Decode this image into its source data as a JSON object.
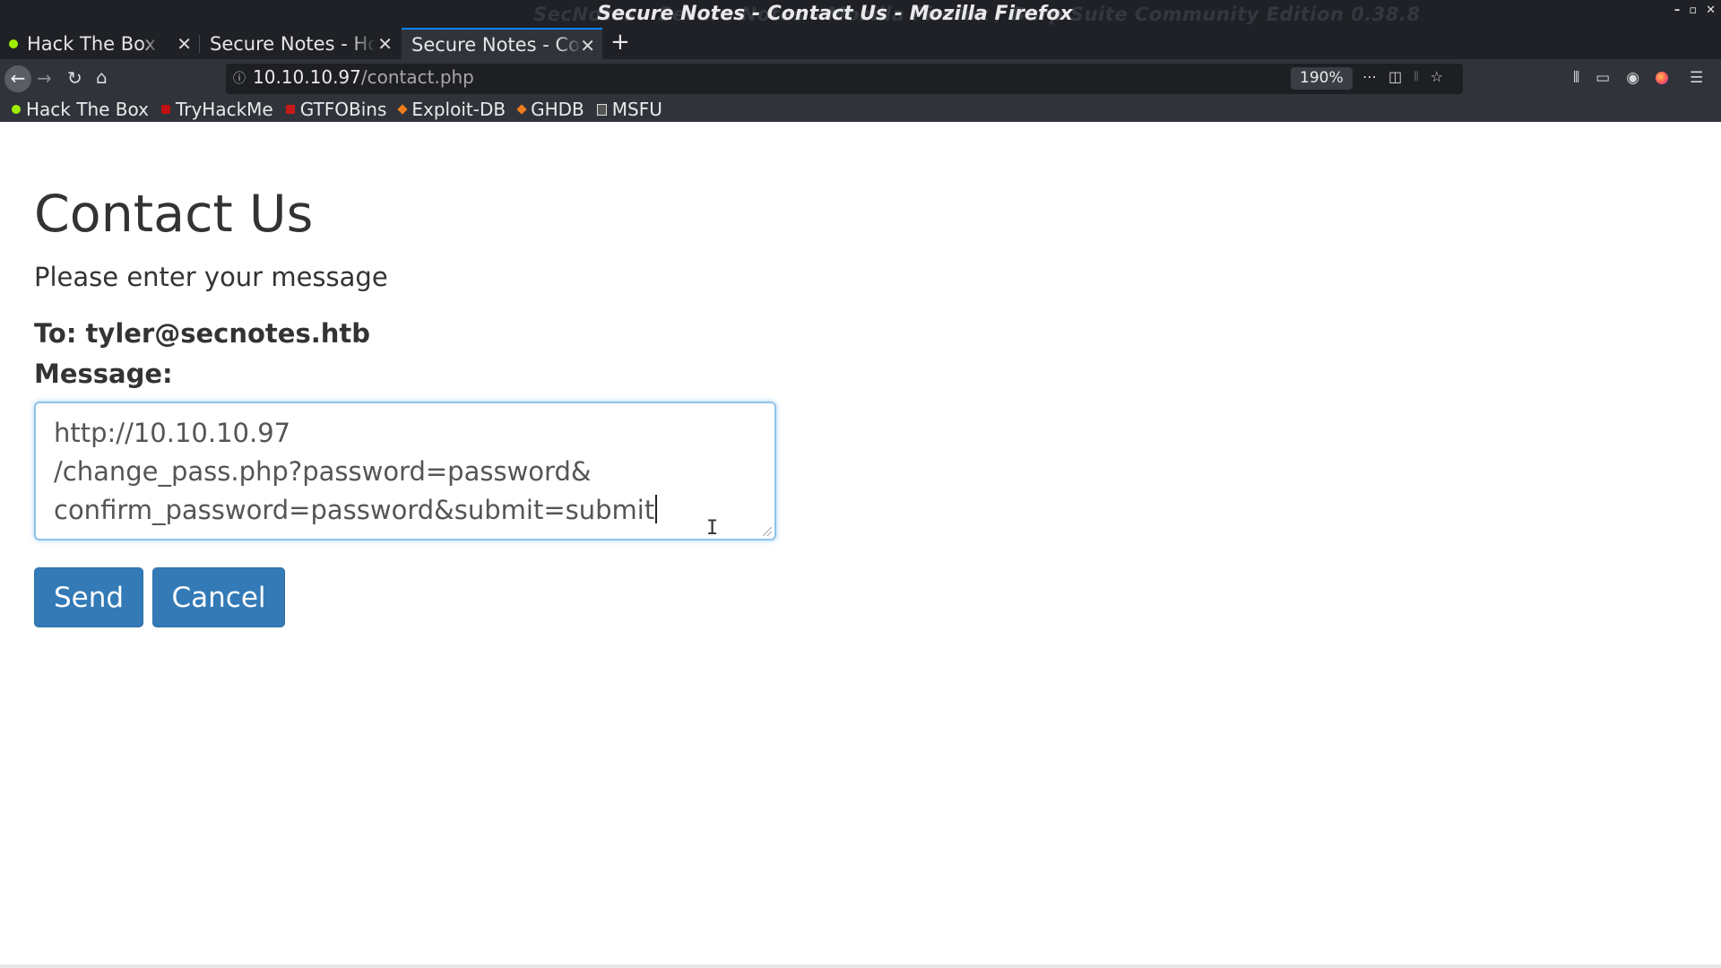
{
  "window": {
    "title": "Secure Notes - Contact Us - Mozilla Firefox",
    "ghost_title": "SecNotes - Secure Notes - Mozilla Firefox / Burp Suite Community Edition 0.38.8",
    "controls": [
      "–",
      "▫",
      "✕"
    ]
  },
  "tabs": [
    {
      "label": "Hack The Box :: Main",
      "active": false
    },
    {
      "label": "Secure Notes - Home",
      "active": false
    },
    {
      "label": "Secure Notes - Contact Us",
      "active": true
    }
  ],
  "navbar": {
    "url_host": "10.10.10.97",
    "url_path": "/contact.php",
    "zoom": "190%"
  },
  "bookmarks": [
    {
      "label": "Hack The Box",
      "icon": "htb-icon"
    },
    {
      "label": "TryHackMe",
      "icon": "tryhackme-icon"
    },
    {
      "label": "GTFOBins",
      "icon": "gtfobins-icon"
    },
    {
      "label": "Exploit-DB",
      "icon": "exploit-db-icon"
    },
    {
      "label": "GHDB",
      "icon": "ghdb-icon"
    },
    {
      "label": "MSFU",
      "icon": "msfu-icon"
    }
  ],
  "page": {
    "title": "Contact Us",
    "subtitle": "Please enter your message",
    "to_line": "To: tyler@secnotes.htb",
    "message_label": "Message:",
    "message_lines": [
      "http://10.10.10.97",
      "/change_pass.php?password=password&",
      "confirm_password=password&submit=submit"
    ],
    "send_label": "Send",
    "cancel_label": "Cancel"
  },
  "colors": {
    "chrome_dark": "#1f2126",
    "toolbar": "#30333a",
    "accent_tab": "#0a84ff",
    "button_primary": "#337ab7",
    "text": "#333333"
  }
}
